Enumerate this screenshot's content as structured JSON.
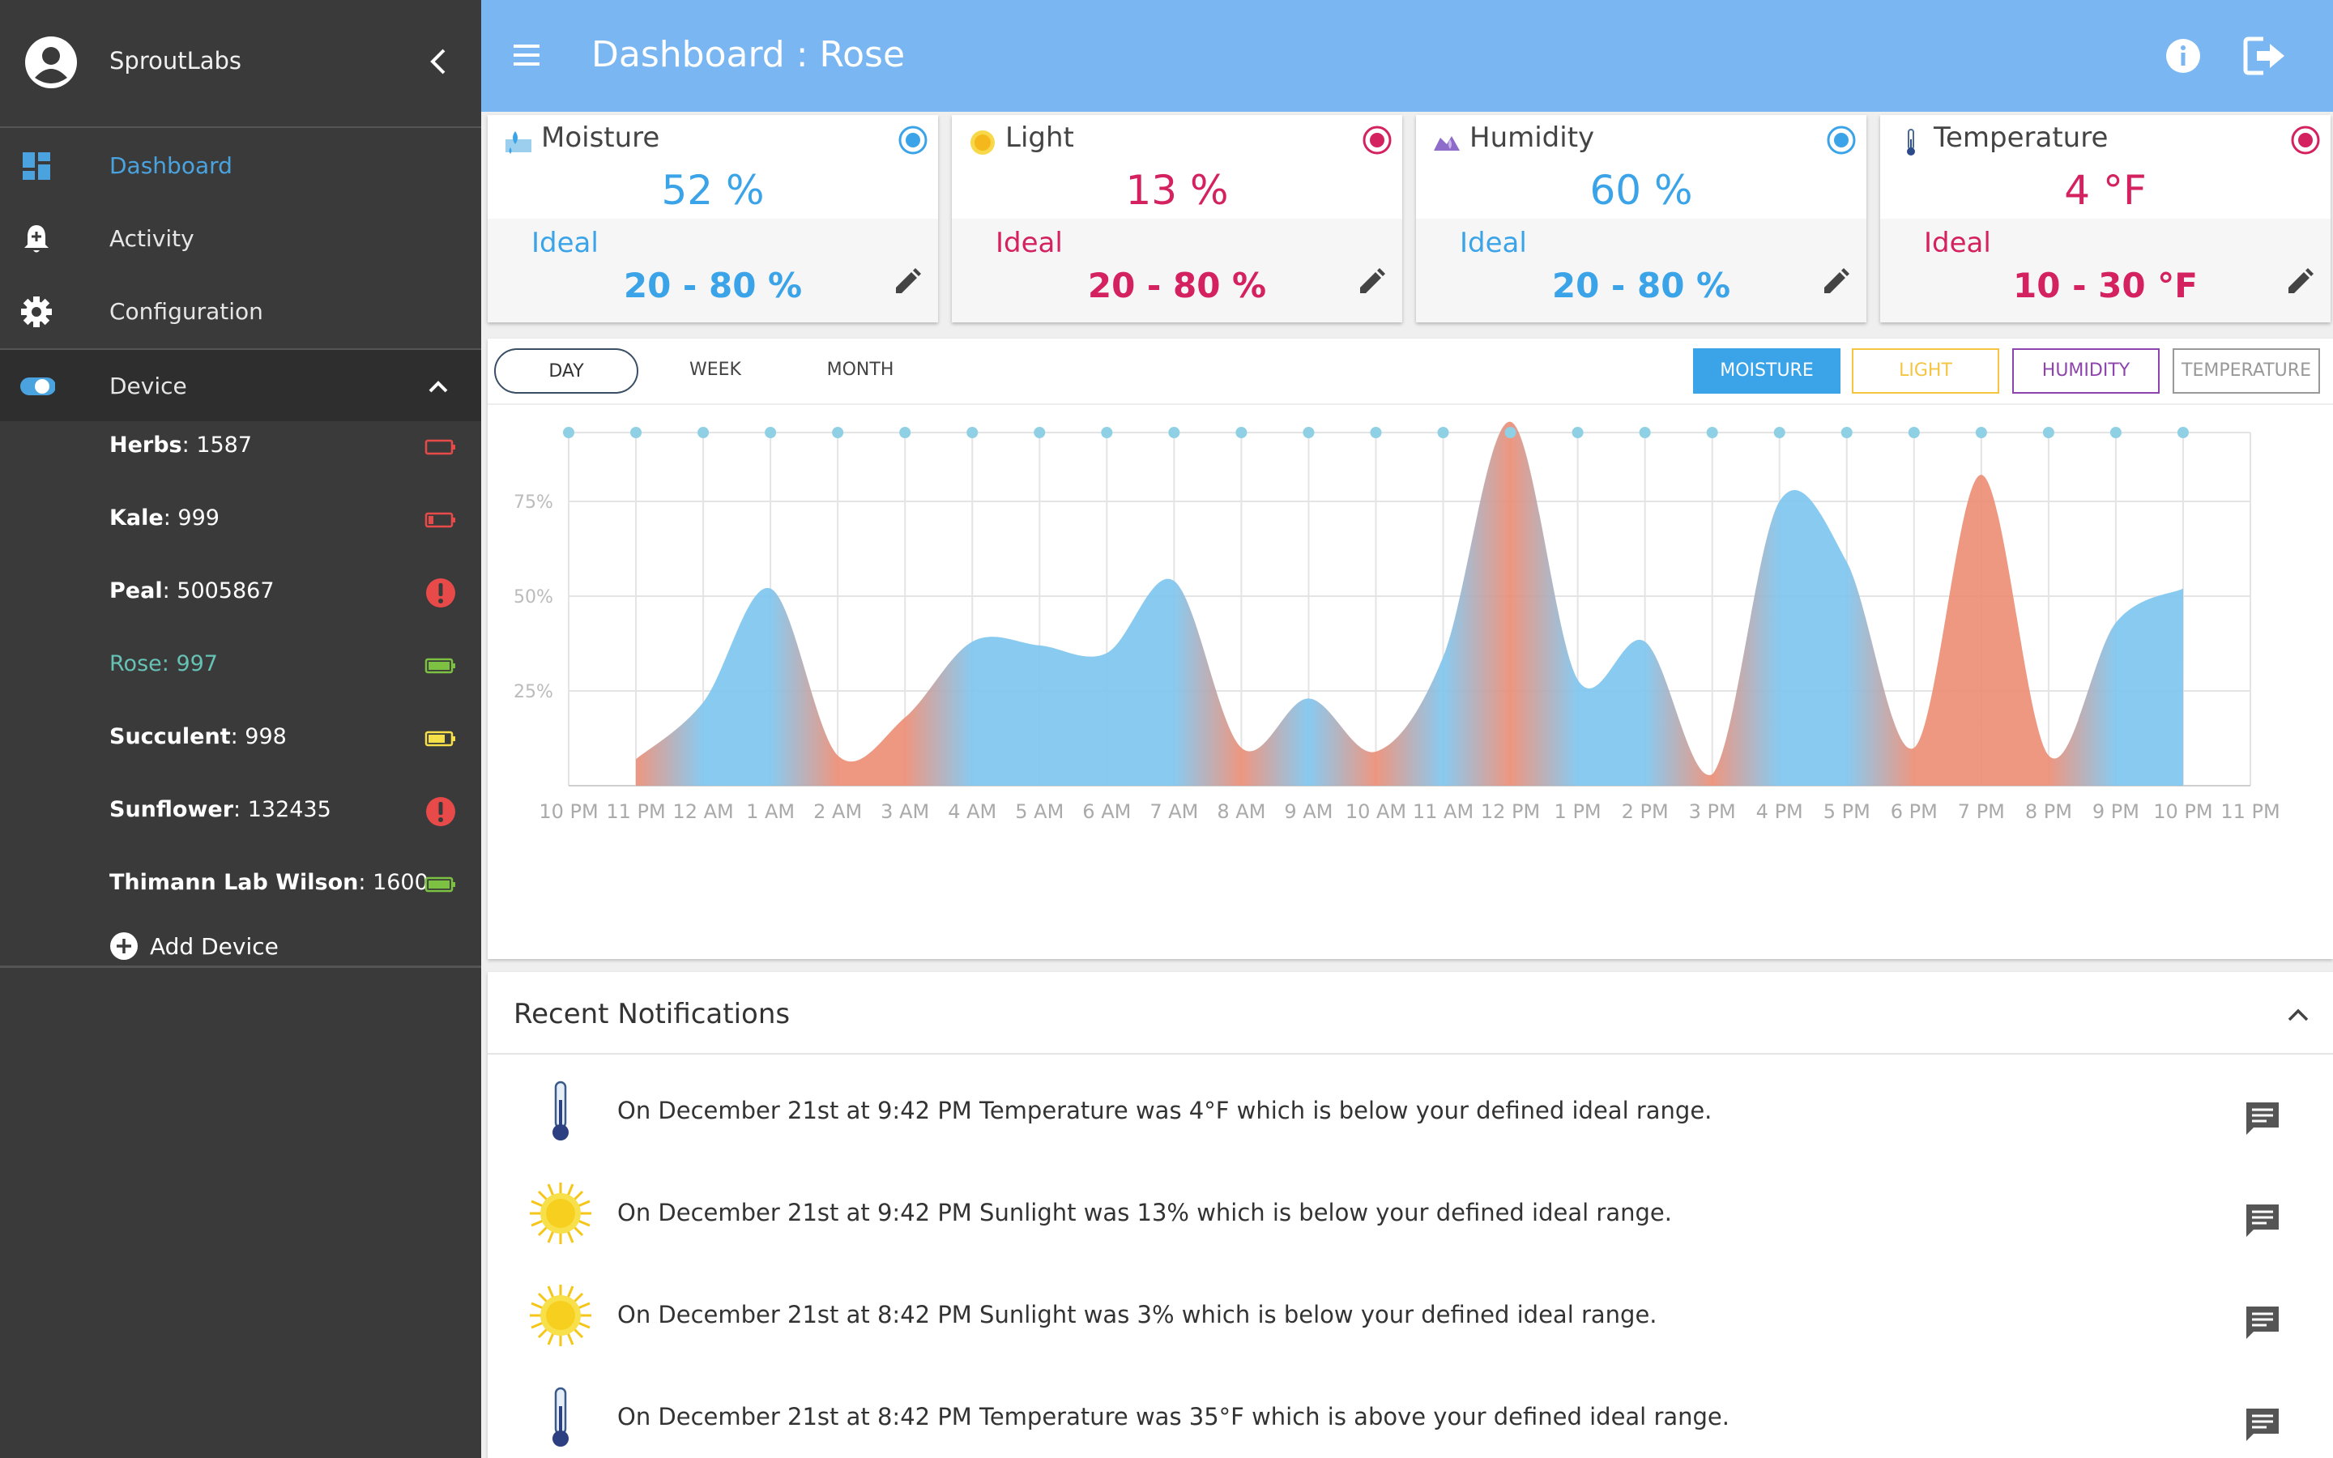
{
  "app": {
    "name": "SproutLabs"
  },
  "header": {
    "title": "Dashboard : Rose"
  },
  "nav": {
    "items": [
      {
        "label": "Dashboard"
      },
      {
        "label": "Activity"
      },
      {
        "label": "Configuration"
      },
      {
        "label": "Device"
      }
    ]
  },
  "devices": [
    {
      "name": "Herbs",
      "value": "1587",
      "status": "battery-empty-icon"
    },
    {
      "name": "Kale",
      "value": "999",
      "status": "battery-low-icon"
    },
    {
      "name": "Peal",
      "value": "5005867",
      "status": "alert-icon"
    },
    {
      "name": "Rose",
      "value": "997",
      "status": "battery-full-icon",
      "active": true
    },
    {
      "name": "Succulent",
      "value": "998",
      "status": "battery-medium-icon"
    },
    {
      "name": "Sunflower",
      "value": "132435",
      "status": "alert-icon"
    },
    {
      "name": "Thimann Lab Wilson",
      "value": "1600",
      "status": "battery-full-icon"
    }
  ],
  "add_device": {
    "label": "Add Device"
  },
  "cards": [
    {
      "title": "Moisture",
      "value": "52 %",
      "ideal_label": "Ideal",
      "range": "20 - 80 %",
      "color": "#3ba4e8",
      "status": "ok"
    },
    {
      "title": "Light",
      "value": "13 %",
      "ideal_label": "Ideal",
      "range": "20 - 80 %",
      "color": "#d4215f",
      "status": "alert"
    },
    {
      "title": "Humidity",
      "value": "60 %",
      "ideal_label": "Ideal",
      "range": "20 - 80 %",
      "color": "#3ba4e8",
      "status": "ok"
    },
    {
      "title": "Temperature",
      "value": "4 °F",
      "ideal_label": "Ideal",
      "range": "10 - 30 °F",
      "color": "#d4215f",
      "status": "alert"
    }
  ],
  "range_tabs": {
    "day": "DAY",
    "week": "WEEK",
    "month": "MONTH",
    "selected": "DAY"
  },
  "metric_tabs": {
    "moisture": "MOISTURE",
    "light": "LIGHT",
    "humidity": "HUMIDITY",
    "temperature": "TEMPERATURE",
    "selected": "MOISTURE"
  },
  "chart_data": {
    "type": "area",
    "x": [
      "10 PM",
      "11 PM",
      "12 AM",
      "1 AM",
      "2 AM",
      "3 AM",
      "4 AM",
      "5 AM",
      "6 AM",
      "7 AM",
      "8 AM",
      "9 AM",
      "10 AM",
      "11 AM",
      "12 PM",
      "1 PM",
      "2 PM",
      "3 PM",
      "4 PM",
      "5 PM",
      "6 PM",
      "7 PM",
      "8 PM",
      "9 PM",
      "10 PM",
      "11 PM"
    ],
    "yticks": [
      "25%",
      "50%",
      "75%"
    ],
    "ylim": [
      0,
      100
    ],
    "ideal_colors": {
      "in_range": "#7fc6ef",
      "out_of_range": "#ec8e76"
    },
    "series": [
      {
        "values": [
          null,
          7,
          22,
          52,
          8,
          18,
          38,
          37,
          35,
          54,
          10,
          23,
          9,
          34,
          96,
          28,
          38,
          3,
          75,
          59,
          10,
          82,
          8,
          43,
          52,
          null
        ],
        "status": [
          "",
          "out",
          "in",
          "in",
          "out",
          "out",
          "in",
          "in",
          "in",
          "in",
          "out",
          "in",
          "out",
          "in",
          "out",
          "in",
          "in",
          "out",
          "in",
          "in",
          "out",
          "out",
          "out",
          "in",
          "in",
          ""
        ]
      }
    ]
  },
  "notifications": {
    "title": "Recent Notifications",
    "items": [
      {
        "icon": "thermometer-icon",
        "text": "On December 21st at 9:42 PM Temperature was 4°F which is below your defined ideal range."
      },
      {
        "icon": "sun-icon",
        "text": "On December 21st at 9:42 PM Sunlight was 13% which is below your defined ideal range."
      },
      {
        "icon": "sun-icon",
        "text": "On December 21st at 8:42 PM Sunlight was 3% which is below your defined ideal range."
      },
      {
        "icon": "thermometer-icon",
        "text": "On December 21st at 8:42 PM Temperature was 35°F which is above your defined ideal range."
      }
    ]
  }
}
